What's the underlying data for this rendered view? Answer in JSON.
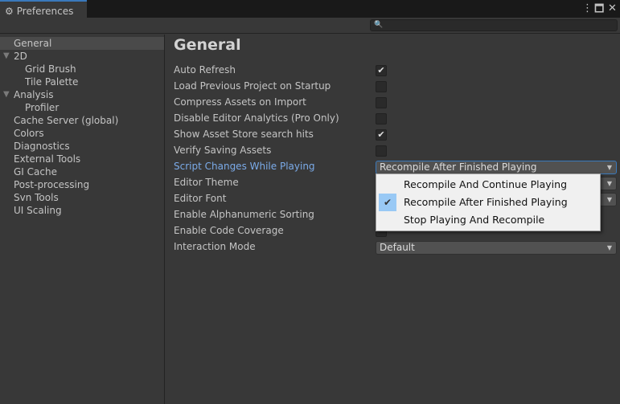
{
  "window": {
    "title": "Preferences",
    "gear_icon": "gear-icon",
    "controls": [
      "more-icon",
      "maximize-icon",
      "close-icon"
    ]
  },
  "search": {
    "placeholder": "",
    "icon": "search-icon"
  },
  "sidebar": {
    "items": [
      {
        "label": "General",
        "level": 1,
        "selected": true
      },
      {
        "label": "2D",
        "level": 1,
        "expanded": true
      },
      {
        "label": "Grid Brush",
        "level": 2
      },
      {
        "label": "Tile Palette",
        "level": 2
      },
      {
        "label": "Analysis",
        "level": 1,
        "expanded": true
      },
      {
        "label": "Profiler",
        "level": 2
      },
      {
        "label": "Cache Server (global)",
        "level": 1
      },
      {
        "label": "Colors",
        "level": 1
      },
      {
        "label": "Diagnostics",
        "level": 1
      },
      {
        "label": "External Tools",
        "level": 1
      },
      {
        "label": "GI Cache",
        "level": 1
      },
      {
        "label": "Post-processing",
        "level": 1
      },
      {
        "label": "Svn Tools",
        "level": 1
      },
      {
        "label": "UI Scaling",
        "level": 1
      }
    ]
  },
  "main": {
    "title": "General",
    "settings": [
      {
        "label": "Auto Refresh",
        "type": "checkbox",
        "checked": true
      },
      {
        "label": "Load Previous Project on Startup",
        "type": "checkbox",
        "checked": false
      },
      {
        "label": "Compress Assets on Import",
        "type": "checkbox",
        "checked": false
      },
      {
        "label": "Disable Editor Analytics (Pro Only)",
        "type": "checkbox",
        "checked": false
      },
      {
        "label": "Show Asset Store search hits",
        "type": "checkbox",
        "checked": true
      },
      {
        "label": "Verify Saving Assets",
        "type": "checkbox",
        "checked": false
      },
      {
        "label": "Script Changes While Playing",
        "type": "dropdown",
        "value": "Recompile After Finished Playing",
        "active": true
      },
      {
        "label": "Editor Theme",
        "type": "dropdown",
        "value": ""
      },
      {
        "label": "Editor Font",
        "type": "dropdown",
        "value": ""
      },
      {
        "label": "Enable Alphanumeric Sorting",
        "type": "checkbox",
        "checked": false
      },
      {
        "label": "Enable Code Coverage",
        "type": "checkbox",
        "checked": false
      },
      {
        "label": "Interaction Mode",
        "type": "dropdown",
        "value": "Default"
      }
    ]
  },
  "popup": {
    "options": [
      {
        "label": "Recompile And Continue Playing",
        "checked": false
      },
      {
        "label": "Recompile After Finished Playing",
        "checked": true
      },
      {
        "label": "Stop Playing And Recompile",
        "checked": false
      }
    ]
  },
  "colors": {
    "accent": "#3a79bb",
    "active_label": "#7babe9",
    "popup_check_bg": "#99c9f5"
  }
}
